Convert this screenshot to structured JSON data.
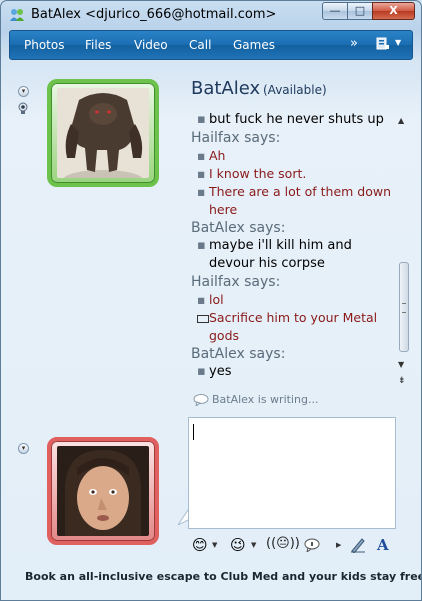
{
  "window": {
    "title": "BatAlex <djurico_666@hotmail.com>"
  },
  "titlebar": {
    "minimize": "—",
    "maximize": "□",
    "close": "X"
  },
  "menu": {
    "items": [
      "Photos",
      "Files",
      "Video",
      "Call",
      "Games"
    ],
    "more": "»"
  },
  "contact": {
    "name": "BatAlex",
    "status": "(Available)"
  },
  "conversation": [
    {
      "type": "msg",
      "text": "but fuck he never shuts up",
      "color": "black"
    },
    {
      "type": "says",
      "text": "Hailfax says:"
    },
    {
      "type": "msg",
      "text": "Ah",
      "color": "red"
    },
    {
      "type": "msg",
      "text": "I know the sort.",
      "color": "red"
    },
    {
      "type": "msg",
      "text": "There are a lot of them down here",
      "color": "red"
    },
    {
      "type": "says",
      "text": "BatAlex says:"
    },
    {
      "type": "msg",
      "text": "maybe i'll kill him and devour his corpse",
      "color": "black"
    },
    {
      "type": "says",
      "text": "Hailfax says:"
    },
    {
      "type": "msg",
      "text": "lol",
      "color": "red"
    },
    {
      "type": "msg",
      "text": "Sacrifice him to your Metal gods",
      "color": "red",
      "bullet": "box"
    },
    {
      "type": "says",
      "text": "BatAlex says:"
    },
    {
      "type": "msg",
      "text": "yes",
      "color": "black"
    }
  ],
  "typing_status": "BatAlex is writing...",
  "compose": {
    "value": ""
  },
  "toolbar": {
    "icons": [
      "emoticon-icon",
      "wink-icon",
      "nudge-icon",
      "voice-clip-icon",
      "handwriting-icon",
      "font-icon"
    ],
    "font_label": "A"
  },
  "ad": {
    "text": "Book an all-inclusive escape to Club Med and your kids stay free"
  },
  "colors": {
    "menubar": "#1b6db2",
    "say_gray": "#5a6b7a",
    "red_text": "#8a1a1a",
    "green_frame": "#6cc24a",
    "red_frame": "#e06060"
  }
}
